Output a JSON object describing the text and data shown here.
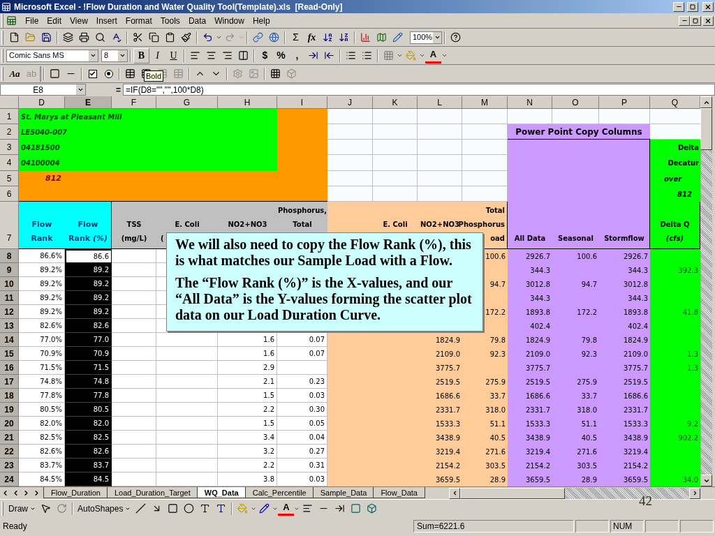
{
  "window": {
    "title": "Microsoft Excel - !Flow Duration and Water Quality Tool(Template).xls  [Read-Only]"
  },
  "menu": [
    "File",
    "Edit",
    "View",
    "Insert",
    "Format",
    "Tools",
    "Data",
    "Window",
    "Help"
  ],
  "standard_toolbar": {
    "glyphs": [
      "Σ",
      "fx"
    ],
    "zoom": "100%"
  },
  "formatting_toolbar": {
    "font": "Comic Sans MS",
    "size": "8",
    "buttons": [
      {
        "label": "B",
        "highlighted": true
      },
      {
        "label": "I",
        "highlighted": false
      },
      {
        "label": "U",
        "highlighted": false
      }
    ],
    "number_buttons": [
      "$",
      "%",
      ","
    ],
    "font_color": "A"
  },
  "forms_toolbar": {
    "label": "Aa",
    "edit_box": "ab"
  },
  "tooltip": "Bold",
  "formula_bar": {
    "name_box": "E8",
    "equals": "=",
    "formula": "=IF(D8=\"\",\"\",100*D8)"
  },
  "columns": [
    {
      "letter": "D",
      "selected": false
    },
    {
      "letter": "E",
      "selected": true
    },
    {
      "letter": "F",
      "selected": false
    },
    {
      "letter": "G",
      "selected": false
    },
    {
      "letter": "H",
      "selected": false
    },
    {
      "letter": "I",
      "selected": false
    },
    {
      "letter": "J",
      "selected": false
    },
    {
      "letter": "K",
      "selected": false
    },
    {
      "letter": "L",
      "selected": false
    },
    {
      "letter": "M",
      "selected": false
    },
    {
      "letter": "N",
      "selected": false
    },
    {
      "letter": "O",
      "selected": false
    },
    {
      "letter": "P",
      "selected": false
    },
    {
      "letter": "Q",
      "selected": false
    }
  ],
  "top_rows": [
    {
      "number": "1",
      "text": "St. Marys at Pleasant Mill"
    },
    {
      "number": "2",
      "text": "LE5040-007"
    },
    {
      "number": "3",
      "text": "04181500"
    },
    {
      "number": "4",
      "text": "04100004"
    },
    {
      "number": "5",
      "text": "812"
    },
    {
      "number": "6"
    }
  ],
  "copy_title": "Power Point Copy Columns",
  "delta_lines": [
    "Delta",
    "Decatur",
    "over",
    "812"
  ],
  "header_row": {
    "number": "7",
    "cells": {
      "D": [
        "Flow",
        "Rank"
      ],
      "E": [
        "Flow",
        "Rank *(%)*"
      ],
      "F": [
        "TSS",
        "(mg/L)"
      ],
      "G": [
        "E. Coli",
        "("
      ],
      "H": [
        "NO2+NO3"
      ],
      "I": [
        "Phosphorus,",
        "Total"
      ],
      "K": [
        "E. Coli"
      ],
      "L": [
        "NO2+NO3"
      ],
      "M": [
        "Total",
        "Phosphorus",
        "oad"
      ],
      "N": [
        "All Data"
      ],
      "O": [
        "Seasonal"
      ],
      "P": [
        "Stormflow"
      ],
      "Q": [
        "Delta Q",
        "*(cfs)*"
      ]
    }
  },
  "rows": [
    {
      "number": "8",
      "selected": true,
      "active": true,
      "cells": {
        "D": "86.6%",
        "E": "86.6",
        "M": "100.6",
        "N": "2926.7",
        "O": "100.6",
        "P": "2926.7"
      }
    },
    {
      "number": "9",
      "selected": true,
      "active": false,
      "cells": {
        "D": "89.2%",
        "E": "89.2",
        "N": "344.3",
        "P": "344.3",
        "Q": "392.3"
      }
    },
    {
      "number": "10",
      "selected": true,
      "active": false,
      "cells": {
        "D": "89.2%",
        "E": "89.2",
        "M": "94.7",
        "N": "3012.8",
        "O": "94.7",
        "P": "3012.8"
      }
    },
    {
      "number": "11",
      "selected": true,
      "active": false,
      "cells": {
        "D": "89.2%",
        "E": "89.2",
        "N": "344.3",
        "P": "344.3"
      }
    },
    {
      "number": "12",
      "selected": true,
      "active": false,
      "cells": {
        "D": "89.2%",
        "E": "89.2",
        "M": "172.2",
        "N": "1893.8",
        "O": "172.2",
        "P": "1893.8",
        "Q": "41.8"
      }
    },
    {
      "number": "13",
      "selected": true,
      "active": false,
      "cells": {
        "D": "82.6%",
        "E": "82.6",
        "N": "402.4",
        "P": "402.4"
      }
    },
    {
      "number": "14",
      "selected": true,
      "active": false,
      "cells": {
        "D": "77.0%",
        "E": "77.0",
        "H": "1.6",
        "I": "0.07",
        "L": "1824.9",
        "M": "79.8",
        "N": "1824.9",
        "O": "79.8",
        "P": "1824.9"
      }
    },
    {
      "number": "15",
      "selected": true,
      "active": false,
      "cells": {
        "D": "70.9%",
        "E": "70.9",
        "H": "1.6",
        "I": "0.07",
        "L": "2109.0",
        "M": "92.3",
        "N": "2109.0",
        "O": "92.3",
        "P": "2109.0",
        "Q": "1.3"
      }
    },
    {
      "number": "16",
      "selected": true,
      "active": false,
      "cells": {
        "D": "71.5%",
        "E": "71.5",
        "H": "2.9",
        "L": "3775.7",
        "N": "3775.7",
        "P": "3775.7",
        "Q": "1.3"
      }
    },
    {
      "number": "17",
      "selected": true,
      "active": false,
      "cells": {
        "D": "74.8%",
        "E": "74.8",
        "H": "2.1",
        "I": "0.23",
        "L": "2519.5",
        "M": "275.9",
        "N": "2519.5",
        "O": "275.9",
        "P": "2519.5"
      }
    },
    {
      "number": "18",
      "selected": true,
      "active": false,
      "cells": {
        "D": "77.8%",
        "E": "77.8",
        "H": "1.5",
        "I": "0.03",
        "L": "1686.6",
        "M": "33.7",
        "N": "1686.6",
        "O": "33.7",
        "P": "1686.6"
      }
    },
    {
      "number": "19",
      "selected": true,
      "active": false,
      "cells": {
        "D": "80.5%",
        "E": "80.5",
        "H": "2.2",
        "I": "0.30",
        "L": "2331.7",
        "M": "318.0",
        "N": "2331.7",
        "O": "318.0",
        "P": "2331.7"
      }
    },
    {
      "number": "20",
      "selected": true,
      "active": false,
      "cells": {
        "D": "82.0%",
        "E": "82.0",
        "H": "1.5",
        "I": "0.05",
        "L": "1533.3",
        "M": "51.1",
        "N": "1533.3",
        "O": "51.1",
        "P": "1533.3",
        "Q": "9.2"
      }
    },
    {
      "number": "21",
      "selected": true,
      "active": false,
      "cells": {
        "D": "82.5%",
        "E": "82.5",
        "H": "3.4",
        "I": "0.04",
        "L": "3438.9",
        "M": "40.5",
        "N": "3438.9",
        "O": "40.5",
        "P": "3438.9",
        "Q": "902.2"
      }
    },
    {
      "number": "22",
      "selected": true,
      "active": false,
      "cells": {
        "D": "82.6%",
        "E": "82.6",
        "H": "3.2",
        "I": "0.27",
        "L": "3219.4",
        "M": "271.6",
        "N": "3219.4",
        "O": "271.6",
        "P": "3219.4"
      }
    },
    {
      "number": "23",
      "selected": true,
      "active": false,
      "cells": {
        "D": "83.7%",
        "E": "83.7",
        "H": "2.2",
        "I": "0.31",
        "L": "2154.2",
        "M": "303.5",
        "N": "2154.2",
        "O": "303.5",
        "P": "2154.2"
      }
    },
    {
      "number": "24",
      "selected": true,
      "active": false,
      "cells": {
        "D": "84.5%",
        "E": "84.5",
        "H": "3.8",
        "I": "0.03",
        "L": "3659.5",
        "M": "28.9",
        "N": "3659.5",
        "O": "28.9",
        "P": "3659.5",
        "Q": "34.0"
      }
    }
  ],
  "callout": [
    "We will also need to copy the Flow Rank (%), this is what matches our Sample Load with a Flow.",
    "The “Flow Rank (%)” is the X-values, and our “All Data” is the Y-values forming the scatter plot data on our Load Duration Curve."
  ],
  "sheet_tabs": [
    {
      "label": "Flow_Duration",
      "selected": false
    },
    {
      "label": "Load_Duration_Target",
      "selected": false
    },
    {
      "label": "WQ_Data",
      "selected": true
    },
    {
      "label": "Calc_Percentile",
      "selected": false
    },
    {
      "label": "Sample_Data",
      "selected": false
    },
    {
      "label": "Flow_Data",
      "selected": false
    }
  ],
  "slide_number": "42",
  "draw_toolbar": {
    "draw": "Draw",
    "autoshapes": "AutoShapes",
    "font_color": "A"
  },
  "status_bar": {
    "text": "Ready",
    "sum": "Sum=6221.6",
    "num": "NUM"
  }
}
